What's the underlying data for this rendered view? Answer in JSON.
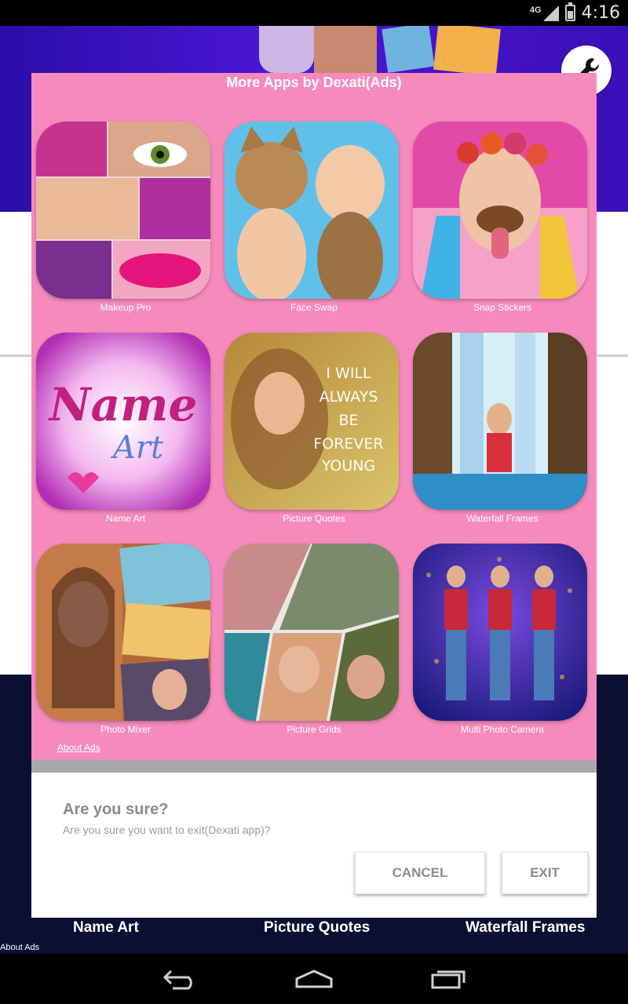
{
  "status_bar": {
    "network": "4G",
    "time": "4:16"
  },
  "dialog": {
    "ads_title": "More Apps by Dexati(Ads)",
    "apps": [
      {
        "label": "Makeup Pro"
      },
      {
        "label": "Face Swap"
      },
      {
        "label": "Snap Stickers"
      },
      {
        "label": "Name Art"
      },
      {
        "label": "Picture Quotes",
        "icon_text": [
          "I WILL",
          "ALWAYS",
          "BE",
          "FOREVER",
          "YOUNG"
        ]
      },
      {
        "label": "Waterfall Frames"
      },
      {
        "label": "Photo Mixer"
      },
      {
        "label": "Picture Grids"
      },
      {
        "label": "Multi Photo Camera"
      }
    ],
    "name_art_icon_text": [
      "Name",
      "Art"
    ],
    "about_ads": "About Ads",
    "confirm_title": "Are you sure?",
    "confirm_message": "Are you sure you want to exit(Dexati app)?",
    "cancel_label": "CANCEL",
    "exit_label": "EXIT"
  },
  "background": {
    "bottom_labels": [
      "Name Art",
      "Picture Quotes",
      "Waterfall Frames"
    ],
    "about_ads": "About Ads"
  },
  "colors": {
    "ads_panel": "#f58abd",
    "banner": "#4d16d6",
    "dark_bg": "#0b1033"
  }
}
